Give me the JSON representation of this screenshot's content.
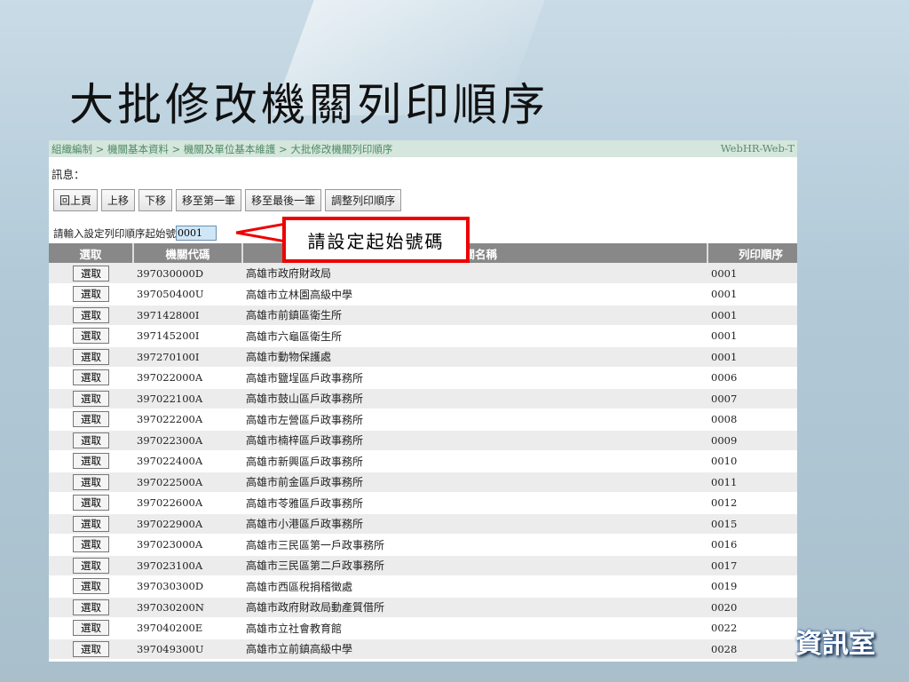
{
  "slide_title": "大批修改機關列印順序",
  "breadcrumb": "組織編制 > 機關基本資料 > 機關及單位基本維護 > 大批修改機關列印順序",
  "system_label": "WebHR-Web-T",
  "message_label": "訊息：",
  "buttons": [
    "回上頁",
    "上移",
    "下移",
    "移至第一筆",
    "移至最後一筆",
    "調整列印順序"
  ],
  "start_label": "請輸入設定列印順序起始號",
  "start_value": "0001",
  "callout": "請設定起始號碼",
  "columns": [
    "選取",
    "機關代碼",
    "機關名稱",
    "列印順序"
  ],
  "select_label": "選取",
  "rows": [
    [
      "397030000D",
      "高雄市政府財政局",
      "0001"
    ],
    [
      "397050400U",
      "高雄市立林園高級中學",
      "0001"
    ],
    [
      "397142800I",
      "高雄市前鎮區衛生所",
      "0001"
    ],
    [
      "397145200I",
      "高雄市六龜區衛生所",
      "0001"
    ],
    [
      "397270100I",
      "高雄市動物保護處",
      "0001"
    ],
    [
      "397022000A",
      "高雄市鹽埕區戶政事務所",
      "0006"
    ],
    [
      "397022100A",
      "高雄市鼓山區戶政事務所",
      "0007"
    ],
    [
      "397022200A",
      "高雄市左營區戶政事務所",
      "0008"
    ],
    [
      "397022300A",
      "高雄市楠梓區戶政事務所",
      "0009"
    ],
    [
      "397022400A",
      "高雄市新興區戶政事務所",
      "0010"
    ],
    [
      "397022500A",
      "高雄市前金區戶政事務所",
      "0011"
    ],
    [
      "397022600A",
      "高雄市苓雅區戶政事務所",
      "0012"
    ],
    [
      "397022900A",
      "高雄市小港區戶政事務所",
      "0015"
    ],
    [
      "397023000A",
      "高雄市三民區第一戶政事務所",
      "0016"
    ],
    [
      "397023100A",
      "高雄市三民區第二戶政事務所",
      "0017"
    ],
    [
      "397030300D",
      "高雄市西區稅捐稽徵處",
      "0019"
    ],
    [
      "397030200N",
      "高雄市政府財政局動產質借所",
      "0020"
    ],
    [
      "397040200E",
      "高雄市立社會教育館",
      "0022"
    ],
    [
      "397049300U",
      "高雄市立前鎮高級中學",
      "0028"
    ]
  ],
  "footer_logo": "資訊室"
}
